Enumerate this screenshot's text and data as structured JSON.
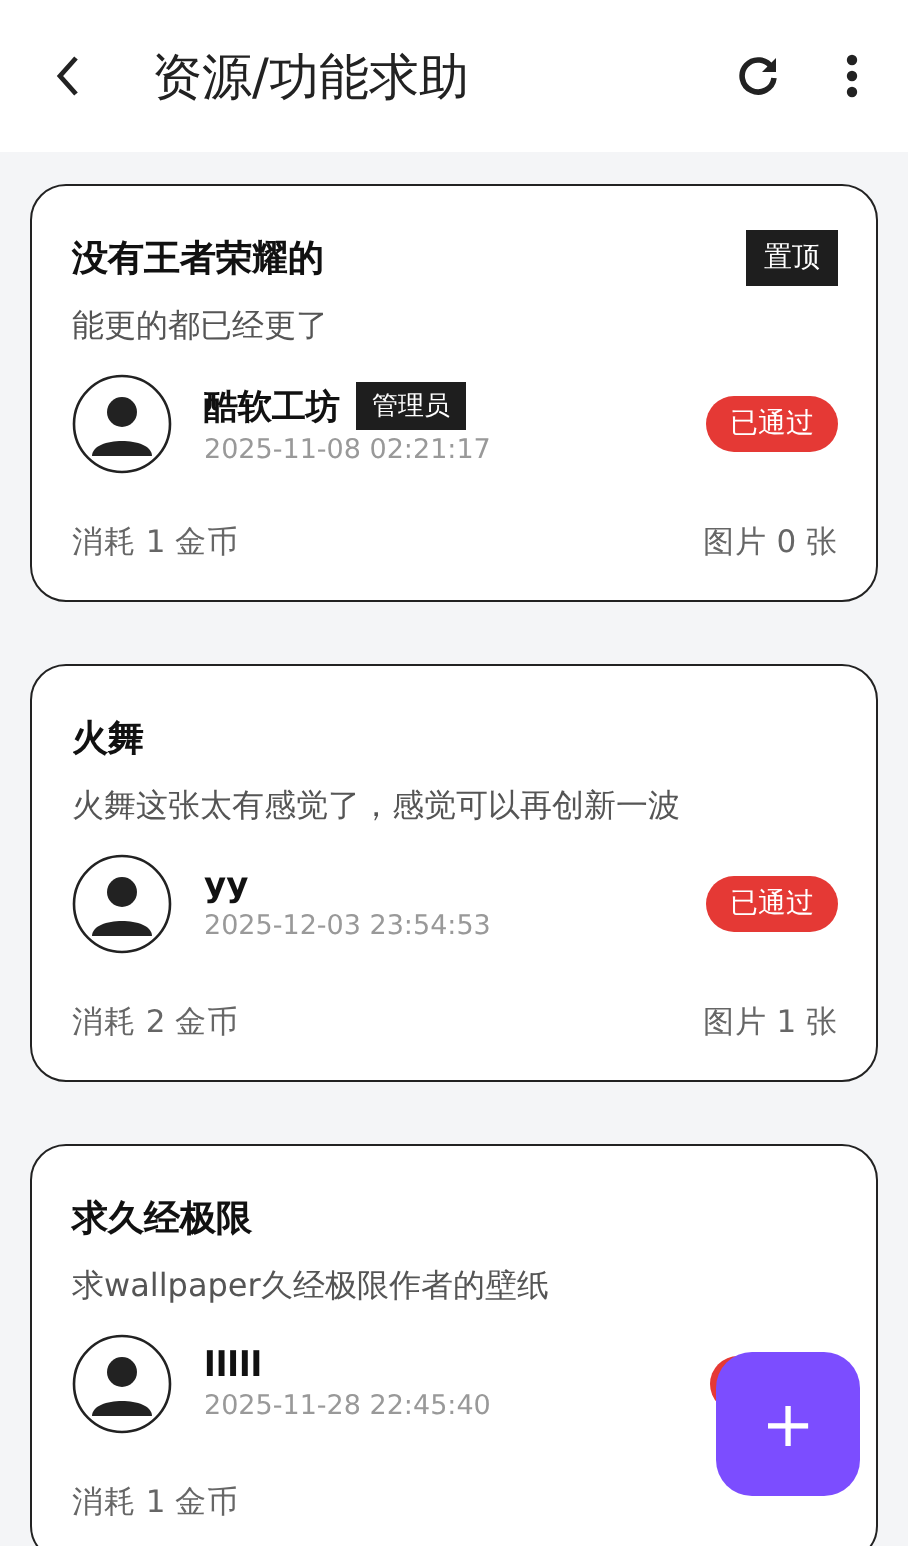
{
  "app_bar": {
    "title": "资源/功能求助"
  },
  "posts": [
    {
      "title": "没有王者荣耀的",
      "pin_tag": "置顶",
      "description": "能更的都已经更了",
      "author": "酷软工坊",
      "role_tag": "管理员",
      "time": "2025-11-08 02:21:17",
      "status": "已通过",
      "color": "#e53935",
      "cost": "消耗 1 金币",
      "images": "图片 0 张"
    },
    {
      "title": "火舞",
      "description": "火舞这张太有感觉了，感觉可以再创新一波",
      "author": "yy",
      "time": "2025-12-03 23:54:53",
      "status": "已通过",
      "color": "#e53935",
      "cost": "消耗 2 金币",
      "images": "图片 1 张"
    },
    {
      "title": "求久经极限",
      "description": "求wallpaper久经极限作者的壁纸",
      "author": "lllll",
      "time": "2025-11-28 22:45:40",
      "color": "#e53935",
      "cost": "消耗 1 金币"
    }
  ],
  "fab": {
    "label": "+"
  }
}
